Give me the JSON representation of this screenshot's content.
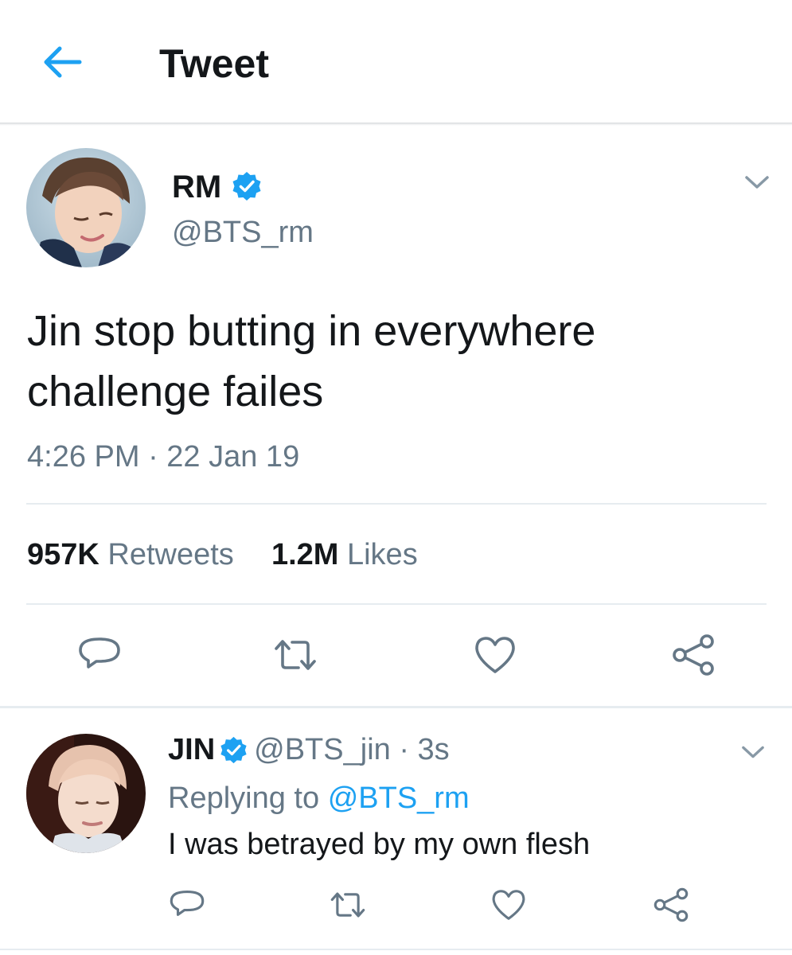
{
  "header": {
    "title": "Tweet"
  },
  "main_tweet": {
    "author_name": "RM",
    "verified": true,
    "handle": "@BTS_rm",
    "text": "Jin stop butting in everywhere challenge failes",
    "timestamp": "4:26 PM · 22 Jan 19",
    "stats": {
      "retweets_count": "957K",
      "retweets_label": "Retweets",
      "likes_count": "1.2M",
      "likes_label": "Likes"
    }
  },
  "reply_tweet": {
    "author_name": "JIN",
    "verified": true,
    "handle_time": "@BTS_jin · 3s",
    "replying_prefix": "Replying to",
    "replying_to": "@BTS_rm",
    "text": "I was betrayed by my own flesh"
  },
  "icons": {
    "back": "arrow-left-icon",
    "verified": "verified-badge-icon",
    "menu": "chevron-down-icon",
    "reply": "speech-bubble-icon",
    "retweet": "retweet-arrows-icon",
    "like": "heart-icon",
    "share": "share-nodes-icon"
  },
  "colors": {
    "accent": "#1da1f2",
    "text_primary": "#14171a",
    "text_secondary": "#657786",
    "icon_gray": "#657786",
    "divider": "#e6ecf0"
  }
}
